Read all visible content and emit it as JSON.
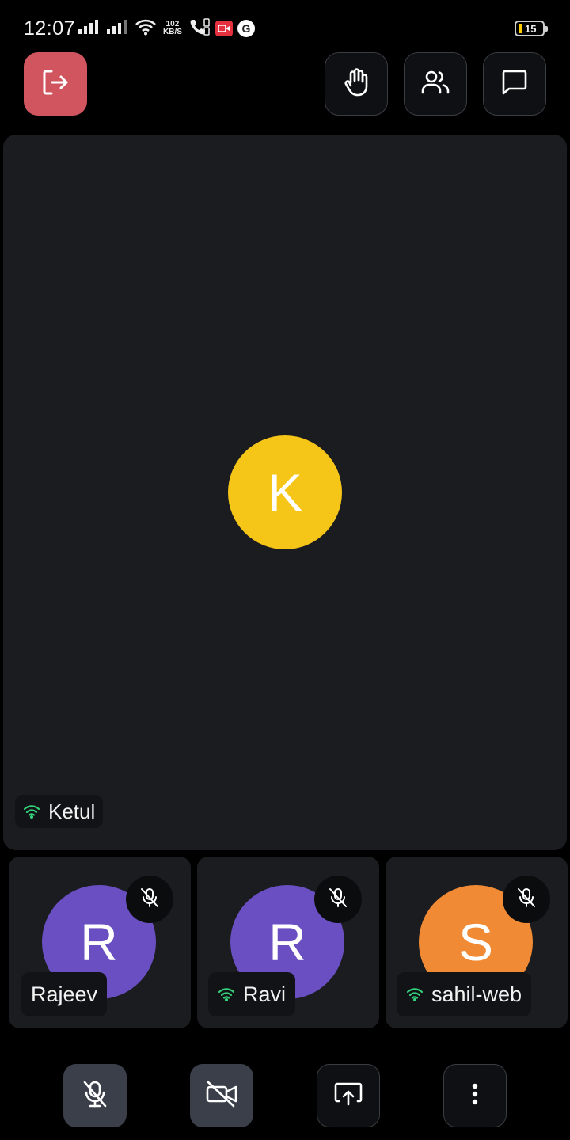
{
  "status_bar": {
    "time": "12:07",
    "net_speed_value": "102",
    "net_speed_unit": "KB/S",
    "google_glyph": "G",
    "battery": "15",
    "icons": [
      "signal-icon",
      "signal-icon",
      "wifi-icon",
      "volte-call-icon",
      "screen-record-icon",
      "google-icon",
      "battery-icon"
    ]
  },
  "top_bar": {
    "leave_icon": "leave-icon",
    "raise_hand_icon": "raise-hand-icon",
    "participants_icon": "participants-icon",
    "chat_icon": "chat-icon",
    "leave_color": "#d0555f"
  },
  "main_participant": {
    "initial": "K",
    "name": "Ketul",
    "avatar_color": "#f5c518",
    "connection": "good"
  },
  "participants": [
    {
      "initial": "R",
      "name": "Rajeev",
      "avatar_color": "#6a4fc2",
      "muted": true,
      "show_wifi": false
    },
    {
      "initial": "R",
      "name": "Ravi",
      "avatar_color": "#6a4fc2",
      "muted": true,
      "show_wifi": true
    },
    {
      "initial": "S",
      "name": "sahil-web",
      "avatar_color": "#f08a35",
      "muted": true,
      "show_wifi": true
    }
  ],
  "controls": {
    "mic_icon": "mic-off-icon",
    "camera_icon": "camera-off-icon",
    "share_icon": "screen-share-icon",
    "more_icon": "more-vertical-icon"
  },
  "colors": {
    "background": "#000000",
    "tile": "#1a1c20",
    "wifi_good": "#34d07a"
  }
}
